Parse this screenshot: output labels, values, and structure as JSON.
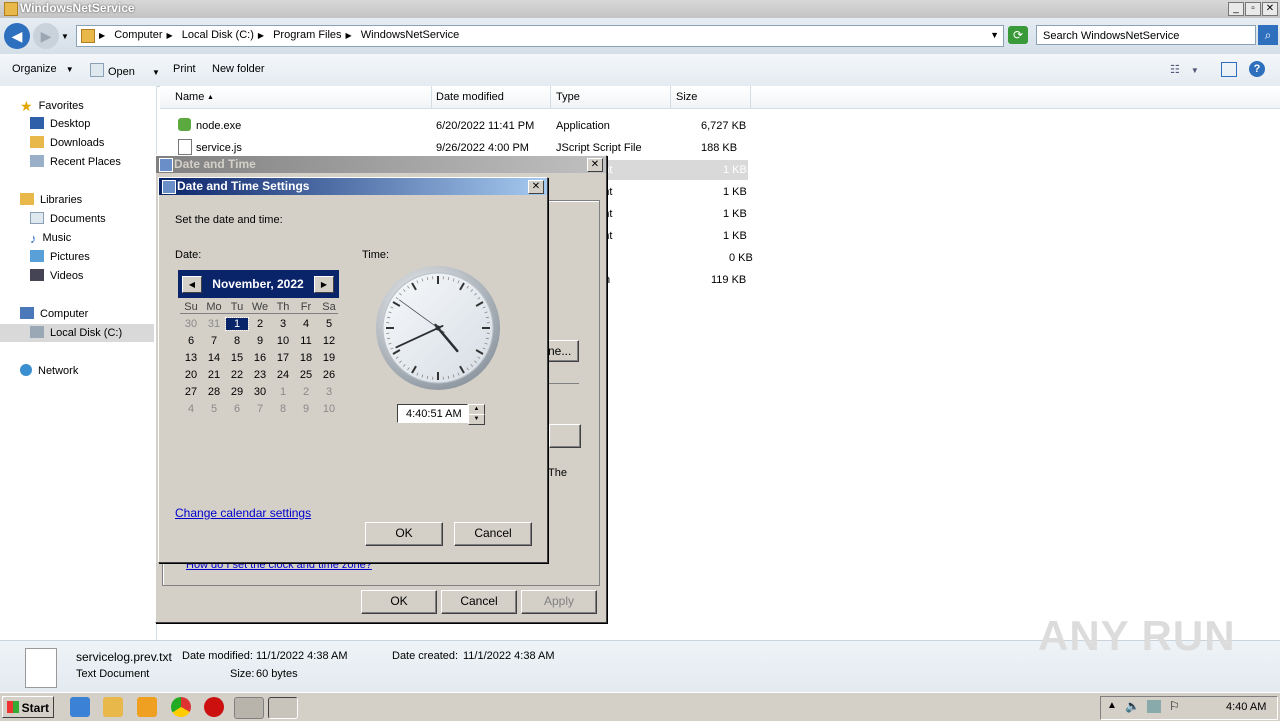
{
  "window": {
    "title": "WindowsNetService"
  },
  "address": {
    "crumbs": [
      "Computer",
      "Local Disk (C:)",
      "Program Files",
      "WindowsNetService"
    ],
    "search_placeholder": "Search WindowsNetService"
  },
  "toolbar": {
    "organize": "Organize",
    "open": "Open",
    "print": "Print",
    "new_folder": "New folder"
  },
  "nav": {
    "favorites": "Favorites",
    "desktop": "Desktop",
    "downloads": "Downloads",
    "recent": "Recent Places",
    "libraries": "Libraries",
    "documents": "Documents",
    "music": "Music",
    "pictures": "Pictures",
    "videos": "Videos",
    "computer": "Computer",
    "local_disk": "Local Disk (C:)",
    "network": "Network"
  },
  "columns": {
    "name": "Name",
    "date": "Date modified",
    "type": "Type",
    "size": "Size"
  },
  "files": [
    {
      "name": "node.exe",
      "date": "6/20/2022 11:41 PM",
      "type": "Application",
      "size": "6,727 KB"
    },
    {
      "name": "service.js",
      "date": "9/26/2022 4:00 PM",
      "type": "JScript Script File",
      "size": "188 KB"
    },
    {
      "name": "",
      "date": "",
      "type": "ment",
      "size": "1 KB"
    },
    {
      "name": "",
      "date": "",
      "type": "ment",
      "size": "1 KB"
    },
    {
      "name": "",
      "date": "",
      "type": "ment",
      "size": "1 KB"
    },
    {
      "name": "",
      "date": "",
      "type": "ment",
      "size": "1 KB"
    },
    {
      "name": "",
      "date": "",
      "type": "",
      "size": "0 KB"
    },
    {
      "name": "",
      "date": "",
      "type": "n",
      "size": "119 KB"
    }
  ],
  "details": {
    "filename": "servicelog.prev.txt",
    "filetype": "Text Document",
    "modified_label": "Date modified:",
    "modified": "11/1/2022 4:38 AM",
    "created_label": "Date created:",
    "created": "11/1/2022 4:38 AM",
    "size_label": "Size:",
    "size": "60 bytes"
  },
  "outer_dialog": {
    "title": "Date and Time",
    "partial_button": "ne...",
    "partial_text": "The",
    "help_link": "How do I set the clock and time zone?",
    "ok": "OK",
    "cancel": "Cancel",
    "apply": "Apply"
  },
  "inner_dialog": {
    "title": "Date and Time Settings",
    "instruction": "Set the date and time:",
    "date_label": "Date:",
    "time_label": "Time:",
    "month": "November, 2022",
    "weekdays": [
      "Su",
      "Mo",
      "Tu",
      "We",
      "Th",
      "Fr",
      "Sa"
    ],
    "weeks": [
      [
        "30",
        "31",
        "1",
        "2",
        "3",
        "4",
        "5"
      ],
      [
        "6",
        "7",
        "8",
        "9",
        "10",
        "11",
        "12"
      ],
      [
        "13",
        "14",
        "15",
        "16",
        "17",
        "18",
        "19"
      ],
      [
        "20",
        "21",
        "22",
        "23",
        "24",
        "25",
        "26"
      ],
      [
        "27",
        "28",
        "29",
        "30",
        "1",
        "2",
        "3"
      ],
      [
        "4",
        "5",
        "6",
        "7",
        "8",
        "9",
        "10"
      ]
    ],
    "selected_day": "1",
    "time_value": "4:40:51 AM",
    "clock": {
      "hour": 4,
      "minute": 40,
      "second": 51
    },
    "calendar_link": "Change calendar settings",
    "ok": "OK",
    "cancel": "Cancel"
  },
  "taskbar": {
    "start": "Start",
    "clock": "4:40 AM"
  },
  "watermark": "ANY RUN"
}
